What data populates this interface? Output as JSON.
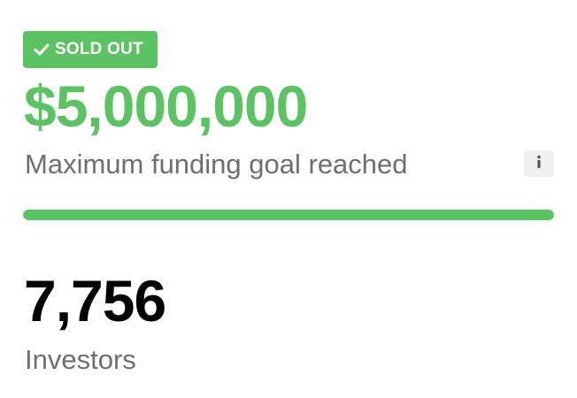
{
  "badge": {
    "label": "SOLD OUT",
    "icon": "check-icon"
  },
  "funding": {
    "amount": "$5,000,000",
    "description": "Maximum funding goal reached",
    "info_icon": "info-icon",
    "progress_percent": 100
  },
  "investors": {
    "count": "7,756",
    "label": "Investors"
  },
  "colors": {
    "accent": "#5cc264",
    "muted_text": "#6f6f6f",
    "info_bg": "#f0f0f0"
  }
}
